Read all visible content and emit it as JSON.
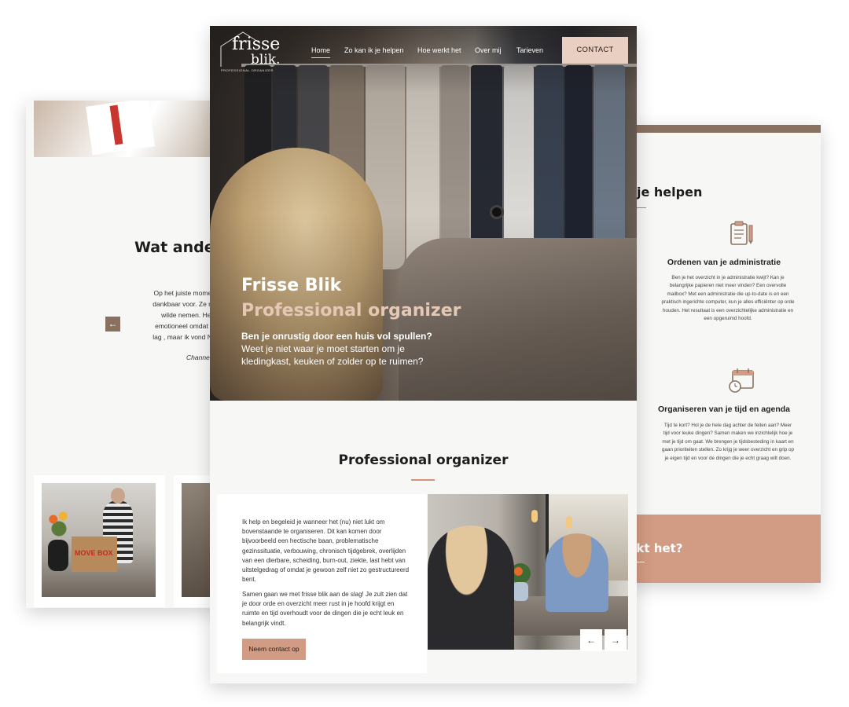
{
  "left_page": {
    "heading": "Wat andere",
    "quote_lines": [
      "Op het juiste moment i",
      "dankbaar voor. Ze resp",
      "wilde nemen. Het",
      "emotioneel omdat er l",
      "lag , maar ik vond Nath"
    ],
    "author": "Channe"
  },
  "right_page": {
    "heading": "je helpen",
    "services": [
      {
        "title": "Ordenen van je administratie",
        "icon": "clipboard-pencil-icon",
        "lines": [
          "Ben je het overzicht in je administratie kwijt? Kan je",
          "belangrijke papieren niet meer vinden? Een overvolle",
          "mailbox? Met een administratie die up-to-date is en een",
          "praktisch ingerichte computer, kun je alles efficiënter op orde",
          "houden. Het resultaat is een overzichtelijke administratie en",
          "een opgeruimd hoofd."
        ]
      },
      {
        "title": "Organiseren van je tijd en agenda",
        "icon": "calendar-clock-icon",
        "lines": [
          "Tijd te kort? Hol je de hele dag achter de feiten aan? Meer",
          "tijd voor leuke dingen? Samen maken we inzichtelijk hoe je",
          "met je tijd om gaat. We brengen je tijdsbesteding in kaart en",
          "gaan prioriteiten stellen. Zo krijg je weer overzicht en grip op",
          "je eigen tijd en voor de dingen die je echt graag wilt doen."
        ]
      }
    ],
    "footer_heading": "rkt het?"
  },
  "center_page": {
    "logo": {
      "line1": "frisse",
      "line2": "blik.",
      "tagline": "PROFESSIONAL ORGANIZER"
    },
    "nav": [
      {
        "label": "Home"
      },
      {
        "label": "Zo kan ik je helpen"
      },
      {
        "label": "Hoe werkt het"
      },
      {
        "label": "Over mij"
      },
      {
        "label": "Tarieven"
      }
    ],
    "contact_label": "CONTACT",
    "hero": {
      "title": "Frisse Blik",
      "subtitle": "Professional organizer",
      "question": "Ben je onrustig door een huis vol spullen?",
      "text_line1": "Weet je niet waar je moet starten om je",
      "text_line2": "kledingkast, keuken of zolder op te ruimen?"
    },
    "section": {
      "title": "Professional organizer",
      "para1": [
        "Ik help en begeleid je wanneer het (nu) niet lukt om",
        "bovenstaande te organiseren. Dit kan komen door",
        "bijvoorbeeld een hectische baan, problematische",
        "gezinssituatie, verbouwing, chronisch tijdgebrek, overlijden",
        "van een dierbare, scheiding, burn-out, ziekte, last hebt van",
        "uitstelgedrag of omdat je gewoon zelf niet zo gestructureerd",
        "bent."
      ],
      "para2": [
        "Samen gaan we met frisse blik aan de slag! Je zult zien dat",
        "je door orde en overzicht meer rust in je hoofd krijgt en",
        "ruimte en tijd overhoudt voor de dingen die je echt leuk en",
        "belangrijk vindt."
      ],
      "cta_label": "Neem contact op",
      "slider_prev": "←",
      "slider_next": "→"
    }
  },
  "colors": {
    "accent": "#d29b83",
    "accent_light": "#e8cfc2",
    "brown": "#8a7260",
    "page_bg": "#f7f7f6"
  }
}
